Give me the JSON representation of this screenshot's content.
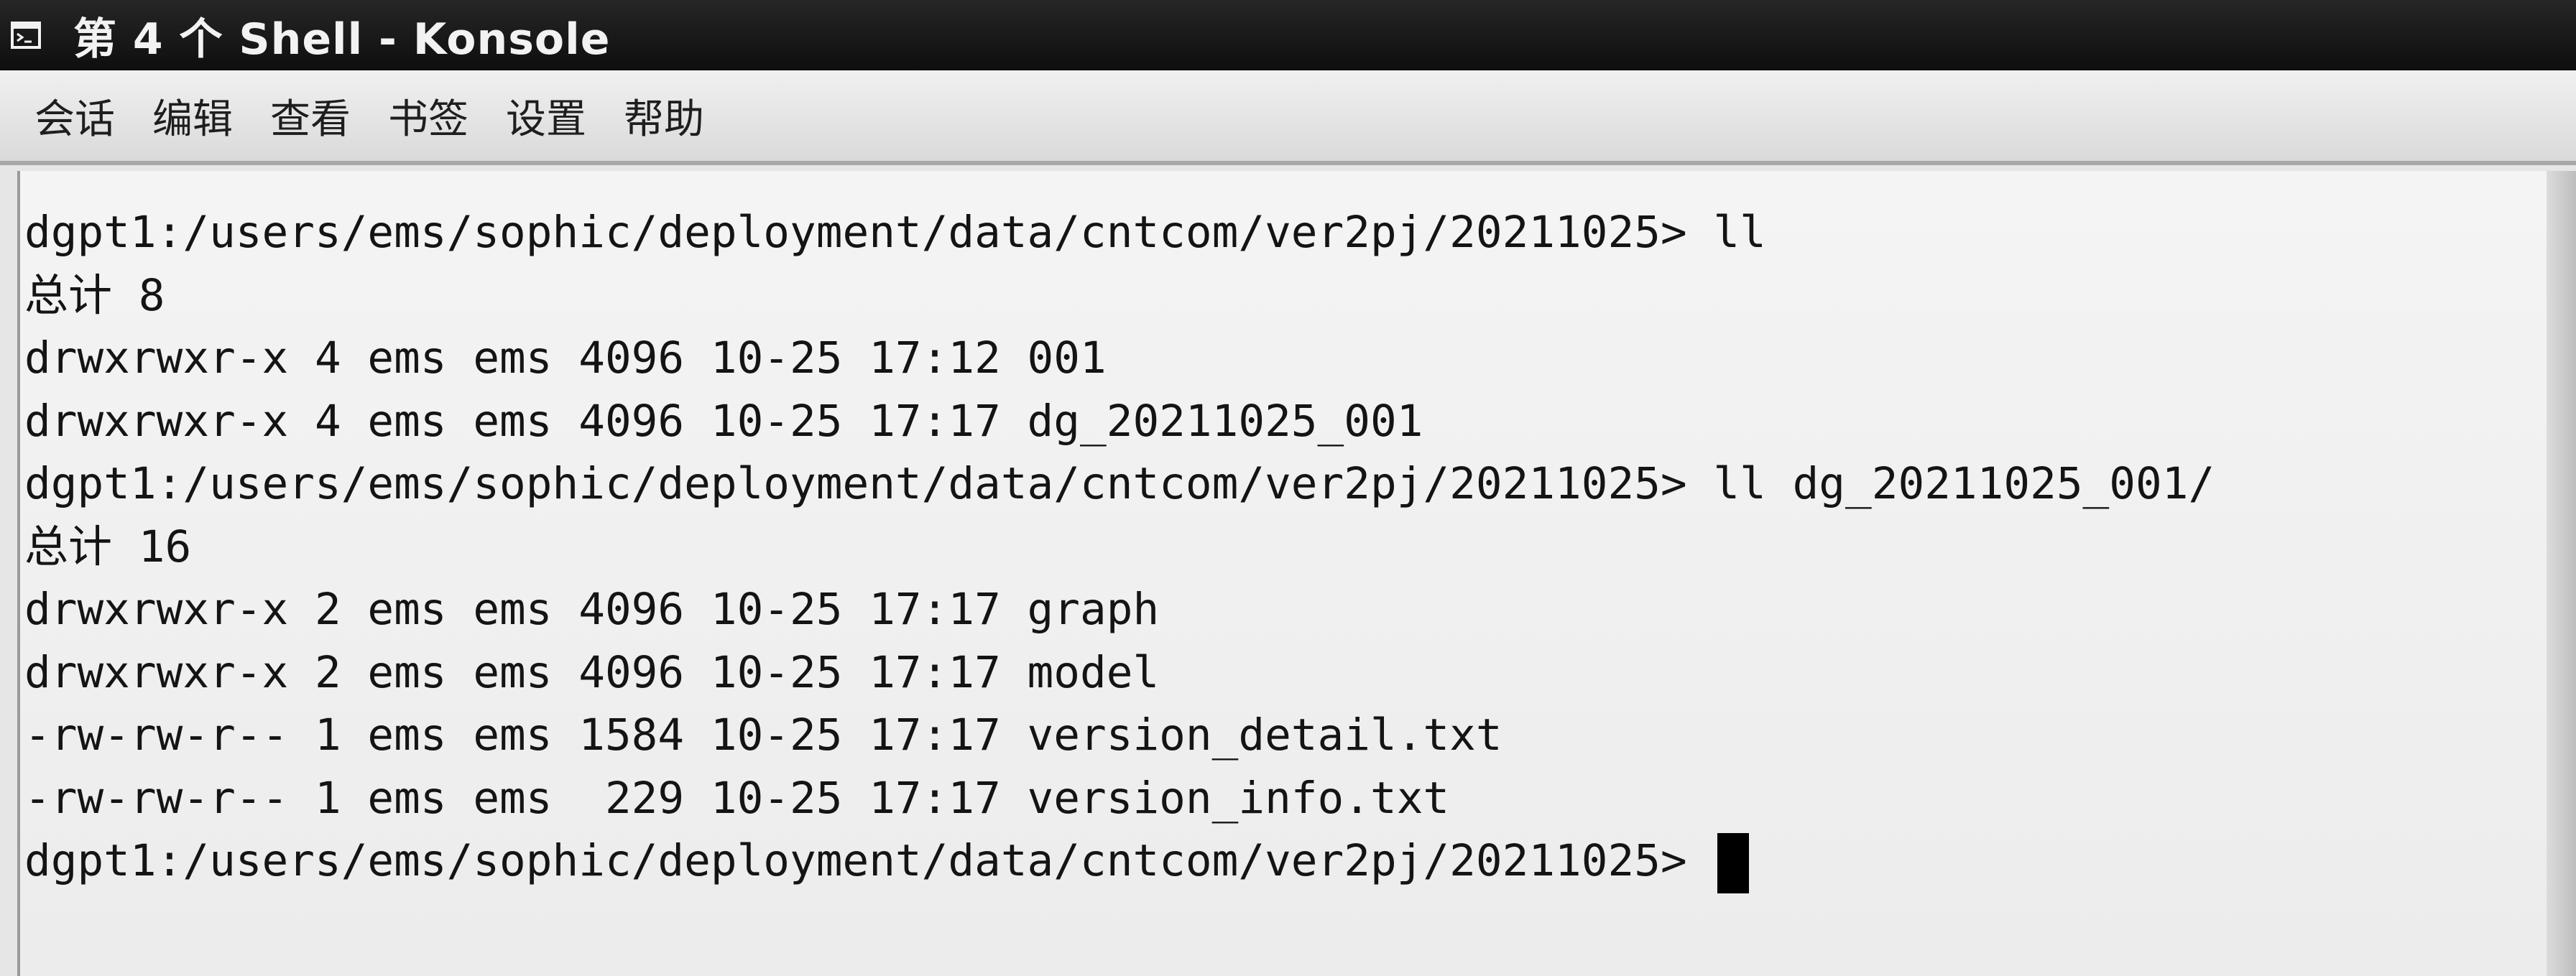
{
  "window": {
    "title": "第 4 个 Shell - Konsole",
    "icon": "terminal-window-icon"
  },
  "menu": {
    "items": [
      "会话",
      "编辑",
      "查看",
      "书签",
      "设置",
      "帮助"
    ]
  },
  "terminal": {
    "lines": [
      "dgpt1:/users/ems/sophic/deployment/data/cntcom/ver2pj/20211025> ll",
      "总计 8",
      "drwxrwxr-x 4 ems ems 4096 10-25 17:12 001",
      "drwxrwxr-x 4 ems ems 4096 10-25 17:17 dg_20211025_001",
      "dgpt1:/users/ems/sophic/deployment/data/cntcom/ver2pj/20211025> ll dg_20211025_001/",
      "总计 16",
      "drwxrwxr-x 2 ems ems 4096 10-25 17:17 graph",
      "drwxrwxr-x 2 ems ems 4096 10-25 17:17 model",
      "-rw-rw-r-- 1 ems ems 1584 10-25 17:17 version_detail.txt",
      "-rw-rw-r-- 1 ems ems  229 10-25 17:17 version_info.txt"
    ],
    "prompt": "dgpt1:/users/ems/sophic/deployment/data/cntcom/ver2pj/20211025> "
  }
}
